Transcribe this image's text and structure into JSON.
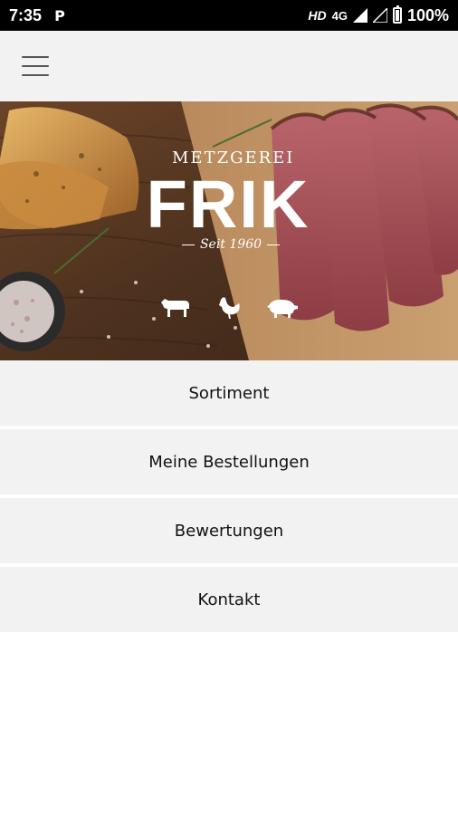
{
  "status_bar": {
    "time": "7:35",
    "parking_icon_glyph": "P",
    "hd": "HD",
    "network": "4G",
    "battery": "100%"
  },
  "app_bar": {
    "menu_icon": "hamburger-menu-icon"
  },
  "hero": {
    "brand_top": "METZGEREI",
    "brand_name": "FRIK",
    "brand_since": "Seit 1960",
    "icons": [
      "cow-icon",
      "chicken-icon",
      "pig-icon"
    ]
  },
  "menu": {
    "items": [
      {
        "label": "Sortiment"
      },
      {
        "label": "Meine Bestellungen"
      },
      {
        "label": "Bewertungen"
      },
      {
        "label": "Kontakt"
      }
    ]
  },
  "colors": {
    "status_bar": "#000000",
    "app_bar": "#f2f2f2",
    "menu_item_bg": "#f2f2f2",
    "menu_item_text": "#111111"
  }
}
